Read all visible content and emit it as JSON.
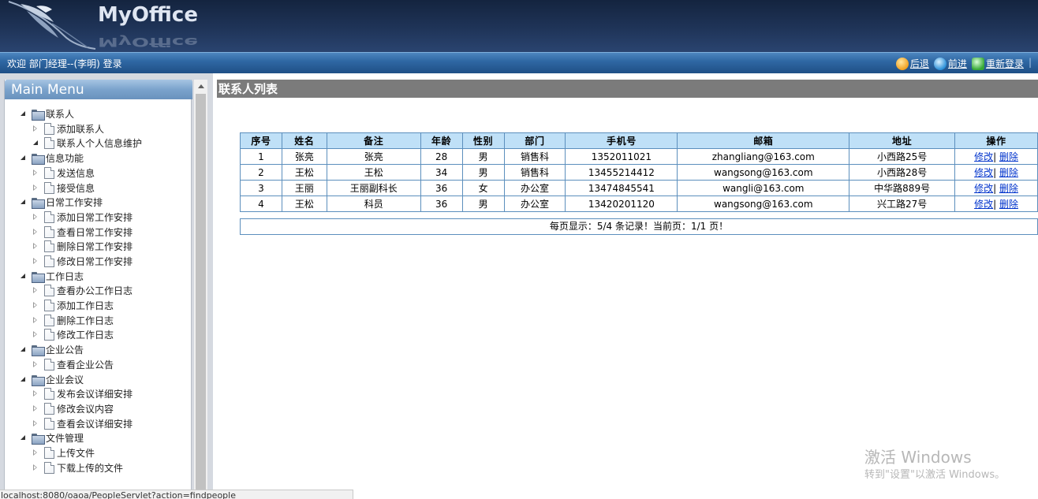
{
  "header": {
    "logo_text": "MyOffice"
  },
  "topbar": {
    "welcome": "欢迎 部门经理--(李明) 登录",
    "back": "后退",
    "forward": "前进",
    "relogin": "重新登录",
    "separator": "|"
  },
  "sidebar": {
    "title": "Main Menu",
    "groups": [
      {
        "label": "联系人",
        "items": [
          "添加联系人",
          "联系人个人信息维护"
        ]
      },
      {
        "label": "信息功能",
        "items": [
          "发送信息",
          "接受信息"
        ]
      },
      {
        "label": "日常工作安排",
        "items": [
          "添加日常工作安排",
          "查看日常工作安排",
          "删除日常工作安排",
          "修改日常工作安排"
        ]
      },
      {
        "label": "工作日志",
        "items": [
          "查看办公工作日志",
          "添加工作日志",
          "删除工作日志",
          "修改工作日志"
        ]
      },
      {
        "label": "企业公告",
        "items": [
          "查看企业公告"
        ]
      },
      {
        "label": "企业会议",
        "items": [
          "发布会议详细安排",
          "修改会议内容",
          "查看会议详细安排"
        ]
      },
      {
        "label": "文件管理",
        "items": [
          "上传文件",
          "下载上传的文件"
        ]
      }
    ]
  },
  "main": {
    "title": "联系人列表",
    "columns": [
      "序号",
      "姓名",
      "备注",
      "年龄",
      "性别",
      "部门",
      "手机号",
      "邮箱",
      "地址",
      "操作"
    ],
    "rows": [
      [
        "1",
        "张亮",
        "张亮",
        "28",
        "男",
        "销售科",
        "1352011021",
        "zhangliang@163.com",
        "小西路25号"
      ],
      [
        "2",
        "王松",
        "王松",
        "34",
        "男",
        "销售科",
        "13455214412",
        "wangsong@163.com",
        "小西路28号"
      ],
      [
        "3",
        "王丽",
        "王丽副科长",
        "36",
        "女",
        "办公室",
        "13474845541",
        "wangli@163.com",
        "中华路889号"
      ],
      [
        "4",
        "王松",
        "科员",
        "36",
        "男",
        "办公室",
        "13420201120",
        "wangsong@163.com",
        "兴工路27号"
      ]
    ],
    "actions": {
      "edit": "修改",
      "sep": "|",
      "delete": "删除"
    },
    "pager": "每页显示：5/4 条记录！当前页：1/1 页！"
  },
  "statusbar": {
    "url": "localhost:8080/oaoa/PeopleServlet?action=findpeople"
  },
  "watermark": {
    "title": "激活 Windows",
    "subtitle": "转到\"设置\"以激活 Windows。"
  }
}
